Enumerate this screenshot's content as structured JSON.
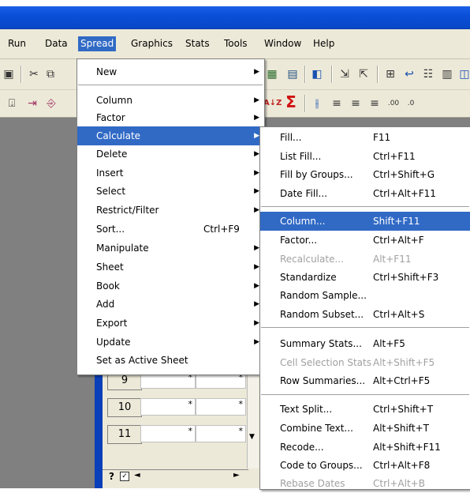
{
  "menubar": {
    "items": [
      "Run",
      "Data",
      "Spread",
      "Graphics",
      "Stats",
      "Tools",
      "Window",
      "Help"
    ],
    "active": "Spread"
  },
  "spread_menu": {
    "items": [
      {
        "label": "New",
        "shortcut": "",
        "submenu": true
      },
      {
        "label": "Column",
        "shortcut": "",
        "submenu": true
      },
      {
        "label": "Factor",
        "shortcut": "",
        "submenu": true
      },
      {
        "label": "Calculate",
        "shortcut": "",
        "submenu": true,
        "selected": true
      },
      {
        "label": "Delete",
        "shortcut": "",
        "submenu": true
      },
      {
        "label": "Insert",
        "shortcut": "",
        "submenu": true
      },
      {
        "label": "Select",
        "shortcut": "",
        "submenu": true
      },
      {
        "label": "Restrict/Filter",
        "shortcut": "",
        "submenu": true
      },
      {
        "label": "Sort...",
        "shortcut": "Ctrl+F9",
        "submenu": false
      },
      {
        "label": "Manipulate",
        "shortcut": "",
        "submenu": true
      },
      {
        "label": "Sheet",
        "shortcut": "",
        "submenu": true
      },
      {
        "label": "Book",
        "shortcut": "",
        "submenu": true
      },
      {
        "label": "Add",
        "shortcut": "",
        "submenu": true
      },
      {
        "label": "Export",
        "shortcut": "",
        "submenu": true
      },
      {
        "label": "Update",
        "shortcut": "",
        "submenu": true
      },
      {
        "label": "Set as Active Sheet",
        "shortcut": "",
        "submenu": false
      }
    ]
  },
  "calculate_menu": {
    "items": [
      {
        "label": "Fill...",
        "shortcut": "F11"
      },
      {
        "label": "List Fill...",
        "shortcut": "Ctrl+F11"
      },
      {
        "label": "Fill by Groups...",
        "shortcut": "Ctrl+Shift+G"
      },
      {
        "label": "Date Fill...",
        "shortcut": "Ctrl+Alt+F11"
      },
      {
        "label": "Column...",
        "shortcut": "Shift+F11",
        "selected": true
      },
      {
        "label": "Factor...",
        "shortcut": "Ctrl+Alt+F"
      },
      {
        "label": "Recalculate...",
        "shortcut": "Alt+F11",
        "disabled": true
      },
      {
        "label": "Standardize",
        "shortcut": "Ctrl+Shift+F3"
      },
      {
        "label": "Random Sample...",
        "shortcut": ""
      },
      {
        "label": "Random Subset...",
        "shortcut": "Ctrl+Alt+S"
      },
      {
        "label": "Summary Stats...",
        "shortcut": "Alt+F5"
      },
      {
        "label": "Cell Selection Stats",
        "shortcut": "Alt+Shift+F5",
        "disabled": true
      },
      {
        "label": "Row Summaries...",
        "shortcut": "Alt+Ctrl+F5"
      },
      {
        "label": "Text Split...",
        "shortcut": "Ctrl+Shift+T"
      },
      {
        "label": "Combine Text...",
        "shortcut": "Alt+Shift+T"
      },
      {
        "label": "Recode...",
        "shortcut": "Alt+Shift+F11"
      },
      {
        "label": "Code to Groups...",
        "shortcut": "Ctrl+Alt+F8"
      },
      {
        "label": "Rebase Dates",
        "shortcut": "Ctrl+Alt+B",
        "disabled": true
      }
    ]
  },
  "spreadsheet": {
    "rows": [
      {
        "num": "9",
        "cells": [
          "*",
          "*"
        ]
      },
      {
        "num": "10",
        "cells": [
          "*",
          "*"
        ]
      },
      {
        "num": "11",
        "cells": [
          "*",
          "*"
        ]
      }
    ],
    "corner_label": "?"
  },
  "toolbar": {
    "sigma": "Σ",
    "sort_label": "A↓Z"
  },
  "colors": {
    "titlebar": "#0a4fd8",
    "menu_highlight": "#316ac5",
    "menubar": "#ece9d8"
  }
}
